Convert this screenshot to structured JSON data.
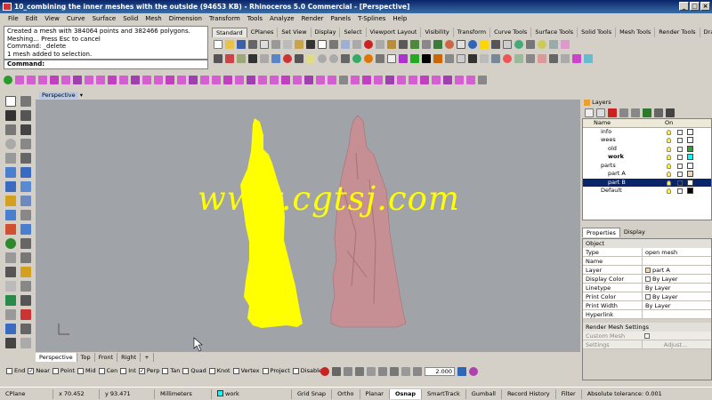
{
  "window": {
    "title": "10_combining the inner meshes with the outside (94653 KB) - Rhinoceros 5.0 Commercial - [Perspective]",
    "minimize": "_",
    "maximize": "□",
    "close": "×"
  },
  "menu": [
    "File",
    "Edit",
    "View",
    "Curve",
    "Surface",
    "Solid",
    "Mesh",
    "Dimension",
    "Transform",
    "Tools",
    "Analyze",
    "Render",
    "Panels",
    "T-Splines",
    "Help"
  ],
  "command": {
    "history": [
      "Created a mesh with 384064 points and 382466 polygons.",
      "Meshing... Press Esc to cancel",
      "Command: _delete",
      "1 mesh added to selection."
    ],
    "prompt": "Command:"
  },
  "toolbar_tabs": [
    "Standard",
    "CPlanes",
    "Set View",
    "Display",
    "Select",
    "Viewport Layout",
    "Visibility",
    "Transform",
    "Curve Tools",
    "Surface Tools",
    "Solid Tools",
    "Mesh Tools",
    "Render Tools",
    "Draftin"
  ],
  "viewport": {
    "title": "Perspective",
    "watermark": "www.cgtsj.com",
    "colors": {
      "background": "#a0a3a8",
      "yellow_statue": "#ffff00",
      "pink_statue": "#c68f93"
    }
  },
  "viewport_tabs": [
    "Perspective",
    "Top",
    "Front",
    "Right"
  ],
  "osnap": [
    {
      "label": "End",
      "checked": false
    },
    {
      "label": "Near",
      "checked": true
    },
    {
      "label": "Point",
      "checked": false
    },
    {
      "label": "Mid",
      "checked": false
    },
    {
      "label": "Cen",
      "checked": false
    },
    {
      "label": "Int",
      "checked": false
    },
    {
      "label": "Perp",
      "checked": true
    },
    {
      "label": "Tan",
      "checked": false
    },
    {
      "label": "Quad",
      "checked": false
    },
    {
      "label": "Knot",
      "checked": false
    },
    {
      "label": "Vertex",
      "checked": false
    },
    {
      "label": "Project",
      "checked": false
    },
    {
      "label": "Disable",
      "checked": false
    }
  ],
  "bottom_value": "2.000",
  "status": {
    "cplane": "CPlane",
    "x": "x 70.452",
    "y": "y 93.471",
    "units": "Millimeters",
    "layer": "work",
    "toggles": [
      "Grid Snap",
      "Ortho",
      "Planar",
      "Osnap",
      "SmartTrack",
      "Gumball",
      "Record History",
      "Filter"
    ],
    "tolerance": "Absolute tolerance: 0.001"
  },
  "layers": {
    "tab": "Layers",
    "header_name": "Name",
    "header_on": "On",
    "rows": [
      {
        "name": "info",
        "indent": 1,
        "color": "#ffffff",
        "selected": false
      },
      {
        "name": "wees",
        "indent": 1,
        "color": "#ffffff",
        "selected": false
      },
      {
        "name": "old",
        "indent": 2,
        "color": "#22aa22",
        "selected": false
      },
      {
        "name": "work",
        "indent": 2,
        "color": "#00ffff",
        "selected": false
      },
      {
        "name": "parts",
        "indent": 1,
        "color": "#ffffff",
        "selected": false
      },
      {
        "name": "part A",
        "indent": 2,
        "color": "#f2d8a8",
        "selected": false
      },
      {
        "name": "part B",
        "indent": 2,
        "color": "#ffffff",
        "selected": true
      },
      {
        "name": "Default",
        "indent": 1,
        "color": "#000000",
        "selected": false
      }
    ]
  },
  "properties": {
    "tabs": [
      "Properties",
      "Display"
    ],
    "section": "Object",
    "rows": [
      {
        "key": "Type",
        "value": "open mesh"
      },
      {
        "key": "Name",
        "value": ""
      },
      {
        "key": "Layer",
        "value": "part A"
      },
      {
        "key": "Display Color",
        "value": "By Layer"
      },
      {
        "key": "Linetype",
        "value": "By Layer"
      },
      {
        "key": "Print Color",
        "value": "By Layer"
      },
      {
        "key": "Print Width",
        "value": "By Layer"
      },
      {
        "key": "Hyperlink",
        "value": ""
      }
    ],
    "render_section": "Render Mesh Settings",
    "custom_mesh": "Custom Mesh",
    "settings": "Settings",
    "adjust": "Adjust..."
  }
}
